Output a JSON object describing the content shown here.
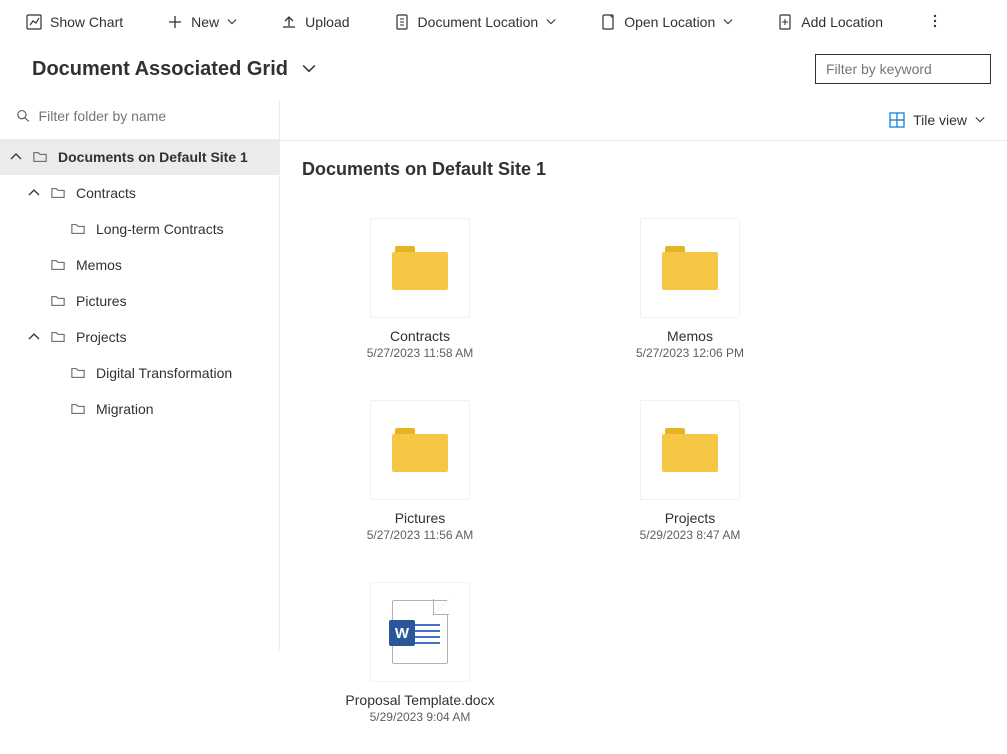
{
  "toolbar": {
    "show_chart": "Show Chart",
    "new": "New",
    "upload": "Upload",
    "doc_location": "Document Location",
    "open_location": "Open Location",
    "add_location": "Add Location"
  },
  "header": {
    "title": "Document Associated Grid",
    "filter_placeholder": "Filter by keyword"
  },
  "sidebar": {
    "filter_placeholder": "Filter folder by name"
  },
  "tree": [
    {
      "label": "Documents on Default Site 1",
      "indent": 0,
      "hasChevron": true,
      "selected": true
    },
    {
      "label": "Contracts",
      "indent": 1,
      "hasChevron": true
    },
    {
      "label": "Long-term Contracts",
      "indent": 2,
      "hasChevron": false
    },
    {
      "label": "Memos",
      "indent": 1,
      "hasChevron": false,
      "pad": true
    },
    {
      "label": "Pictures",
      "indent": 1,
      "hasChevron": false,
      "pad": true
    },
    {
      "label": "Projects",
      "indent": 1,
      "hasChevron": true
    },
    {
      "label": "Digital Transformation",
      "indent": 2,
      "hasChevron": false
    },
    {
      "label": "Migration",
      "indent": 2,
      "hasChevron": false
    }
  ],
  "main": {
    "title": "Documents on Default Site 1",
    "view_mode": "Tile view"
  },
  "tiles": [
    {
      "name": "Contracts",
      "meta": "5/27/2023 11:58 AM",
      "type": "folder"
    },
    {
      "name": "Memos",
      "meta": "5/27/2023 12:06 PM",
      "type": "folder"
    },
    {
      "name": "Pictures",
      "meta": "5/27/2023 11:56 AM",
      "type": "folder"
    },
    {
      "name": "Projects",
      "meta": "5/29/2023 8:47 AM",
      "type": "folder"
    },
    {
      "name": "Proposal Template.docx",
      "meta": "5/29/2023 9:04 AM",
      "type": "word"
    }
  ]
}
